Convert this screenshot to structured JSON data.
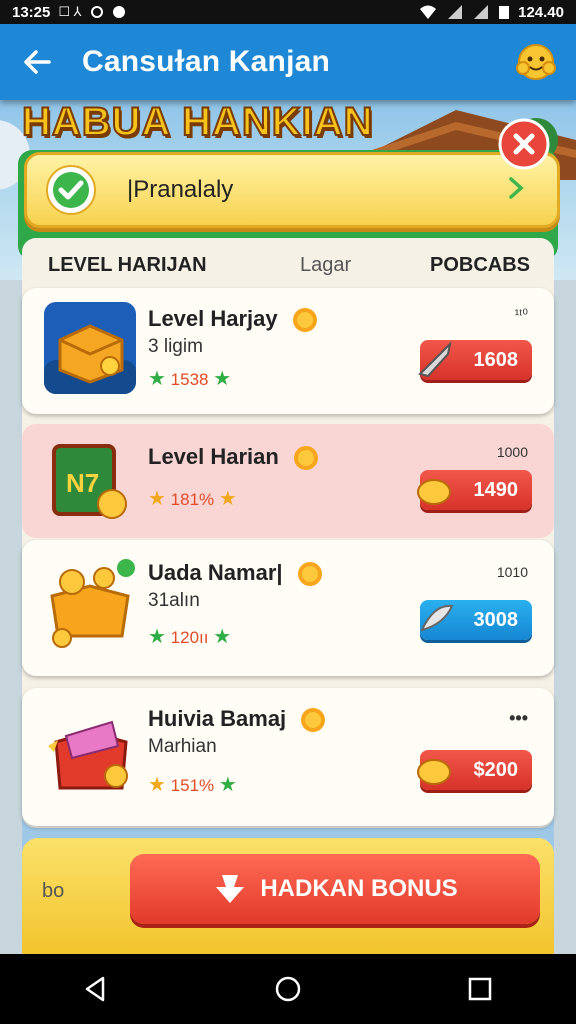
{
  "status_bar": {
    "time": "13:25",
    "icons_left": "☐ ⅄",
    "battery_text": "124.40"
  },
  "app_bar": {
    "title": "Cansuɫan Kanjan"
  },
  "banner": {
    "title": "HABUA HANKIAN"
  },
  "search": {
    "value": "|Pranalaly"
  },
  "table_header": {
    "col1": "LEVEL HARIJAN",
    "col2": "Lagar",
    "col3": "POBCABS"
  },
  "items": [
    {
      "name": "Level Harjay",
      "sub": "3 ligim",
      "rating": "1538",
      "qty": "¹ᵗ⁰",
      "price": "1608",
      "price_style": "red",
      "icon": "gold-chest-icon"
    },
    {
      "name": "Level Harian",
      "sub": "",
      "rating": "181%",
      "qty": "1000",
      "price": "1490",
      "price_style": "red",
      "icon": "cash-box-icon"
    },
    {
      "name": "Uada Namar|",
      "sub": "31alın",
      "rating": "120ıı",
      "qty": "1010",
      "price": "3008",
      "price_style": "blue",
      "icon": "coin-box-icon"
    },
    {
      "name": "Huivia Bamaj",
      "sub": "Marhian",
      "rating": "151%",
      "qty": "•••",
      "price": "$200",
      "price_style": "red",
      "icon": "gift-box-icon"
    }
  ],
  "bottom": {
    "left_text": "bo",
    "button_label": "HADKAN BONUS"
  },
  "colors": {
    "appbar": "#1e88d6",
    "green": "#2fa84a",
    "yellow": "#f7d24e",
    "red": "#e23a2b",
    "blue": "#1686d2"
  }
}
